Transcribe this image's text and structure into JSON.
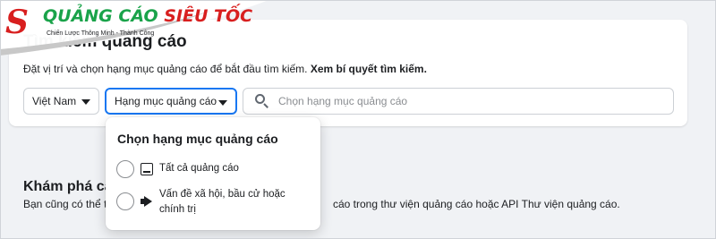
{
  "logo": {
    "mark": "S",
    "brand_part1": "QUẢNG CÁO",
    "brand_part2": "SIÊU TỐC",
    "tagline": "Chiến Lược Thông Minh - Thành Công"
  },
  "search_section": {
    "title": "Tìm kiếm quảng cáo",
    "desc_text": "Đặt vị trí và chọn hạng mục quảng cáo để bắt đầu tìm kiếm.",
    "desc_link": "Xem bí quyết tìm kiếm.",
    "country_value": "Việt Nam",
    "category_value": "Hạng mục quảng cáo",
    "search_placeholder": "Chọn hạng mục quảng cáo"
  },
  "dropdown": {
    "title": "Chọn hạng mục quảng cáo",
    "options": [
      {
        "label": "Tất cả quảng cáo",
        "icon": "ad-icon"
      },
      {
        "label": "Vấn đề xã hội, bầu cử hoặc chính trị",
        "icon": "megaphone-icon"
      }
    ]
  },
  "explore": {
    "title": "Khám phá các",
    "desc_left": "Bạn cũng có thể ti",
    "desc_right": "cáo trong thư viện quảng cáo hoặc API Thư viện quảng cáo."
  },
  "colors": {
    "accent": "#1877f2",
    "brand_red": "#d81f1f",
    "brand_green": "#1aa34a",
    "background": "#f0f2f5"
  }
}
